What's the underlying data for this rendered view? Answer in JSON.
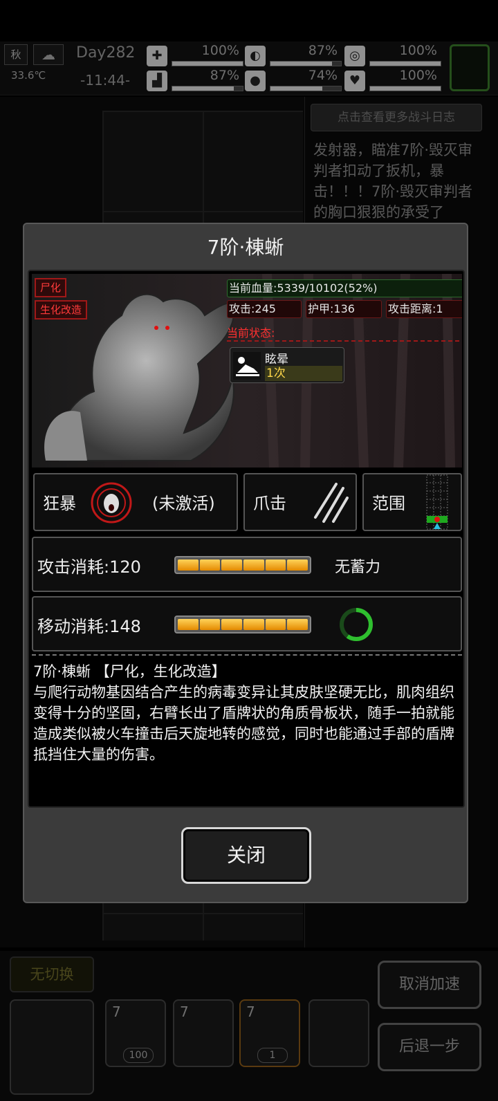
{
  "hud": {
    "season": "秋",
    "temperature": "33.6℃",
    "day": "Day282",
    "clock": "-11:44-",
    "stats": [
      {
        "icon": "medkit-icon",
        "glyph": "✚",
        "value": "100%",
        "level": 1.0
      },
      {
        "icon": "stomach-icon",
        "glyph": "◐",
        "value": "87%",
        "level": 0.87
      },
      {
        "icon": "bladder-icon",
        "glyph": "◎",
        "value": "100%",
        "level": 1.0
      },
      {
        "icon": "boot-icon",
        "glyph": "▟",
        "value": "87%",
        "level": 0.87
      },
      {
        "icon": "water-drop-icon",
        "glyph": "●",
        "value": "74%",
        "level": 0.74
      },
      {
        "icon": "heart-icon",
        "glyph": "♥",
        "value": "100%",
        "level": 1.0
      }
    ]
  },
  "log": {
    "button": "点击查看更多战斗日志",
    "text": "发射器，瞄准7阶·毁灭审判者扣动了扳机，暴击！！！7阶·毁灭审判者的胸口狠狠的承受了"
  },
  "bottom": {
    "no_switch": "无切换",
    "cancel_speed": "取消加速",
    "step_back": "后退一步",
    "slots": [
      {
        "num": "7",
        "count": "100"
      },
      {
        "num": "7",
        "count": ""
      },
      {
        "num": "7",
        "count": "1"
      }
    ]
  },
  "dialog": {
    "title": "7阶·棟蜥",
    "tags": [
      "尸化",
      "生化改造"
    ],
    "hp": "当前血量:5339/10102(52%)",
    "attack": "攻击:245",
    "armor": "护甲:136",
    "range": "攻击距离:1",
    "current_state_label": "当前状态:",
    "status": {
      "name": "眩晕",
      "count": "1次"
    },
    "skills": {
      "berserk": "狂暴",
      "berserk_state": "(未激活)",
      "claw": "爪击",
      "area": "范围"
    },
    "attack_cost": {
      "label": "攻击消耗:120",
      "note": "无蓄力",
      "segments": 6
    },
    "move_cost": {
      "label": "移动消耗:148",
      "segments": 6,
      "ring_level": 0.6
    },
    "description": "7阶·棟蜥 【尸化，生化改造】\n与爬行动物基因结合产生的病毒变异让其皮肤坚硬无比，肌肉组织变得十分的坚固，右臂长出了盾牌状的角质骨板状，随手一拍就能造成类似被火车撞击后天旋地转的感觉，同时也能通过手部的盾牌抵挡住大量的伤害。",
    "close": "关闭"
  }
}
